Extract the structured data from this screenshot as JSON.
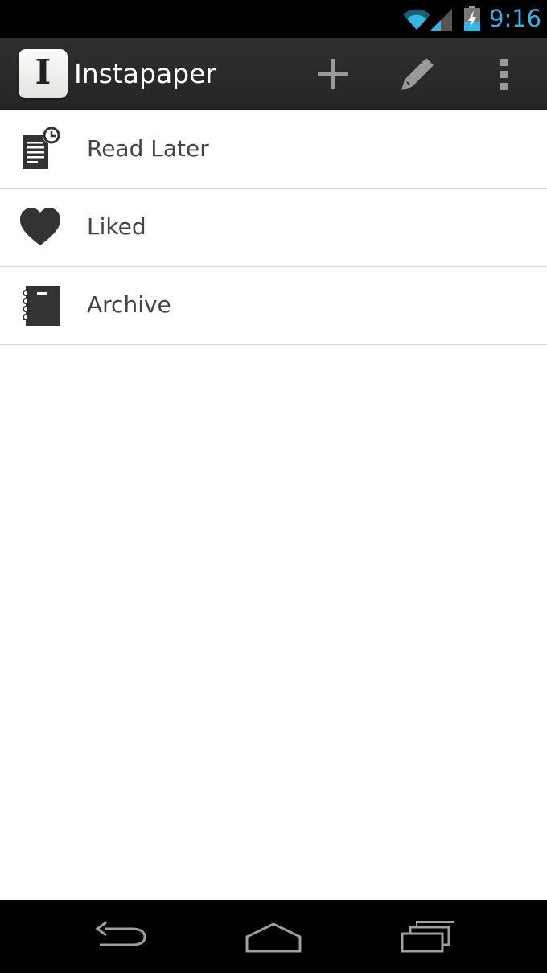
{
  "status_bar": {
    "time": "9:16",
    "icons": [
      "wifi-icon",
      "signal-icon",
      "battery-charging-icon"
    ],
    "accent_color": "#33b5e5"
  },
  "action_bar": {
    "app_icon": "instapaper-logo",
    "app_icon_letter": "I",
    "title": "Instapaper",
    "actions": [
      "add-icon",
      "pencil-icon",
      "overflow-menu-icon"
    ]
  },
  "menu": {
    "items": [
      {
        "label": "Read Later",
        "icon": "read-later-icon"
      },
      {
        "label": "Liked",
        "icon": "heart-icon"
      },
      {
        "label": "Archive",
        "icon": "archive-notebook-icon"
      }
    ]
  },
  "nav_bar": {
    "buttons": [
      "back-icon",
      "home-icon",
      "recent-apps-icon"
    ]
  }
}
